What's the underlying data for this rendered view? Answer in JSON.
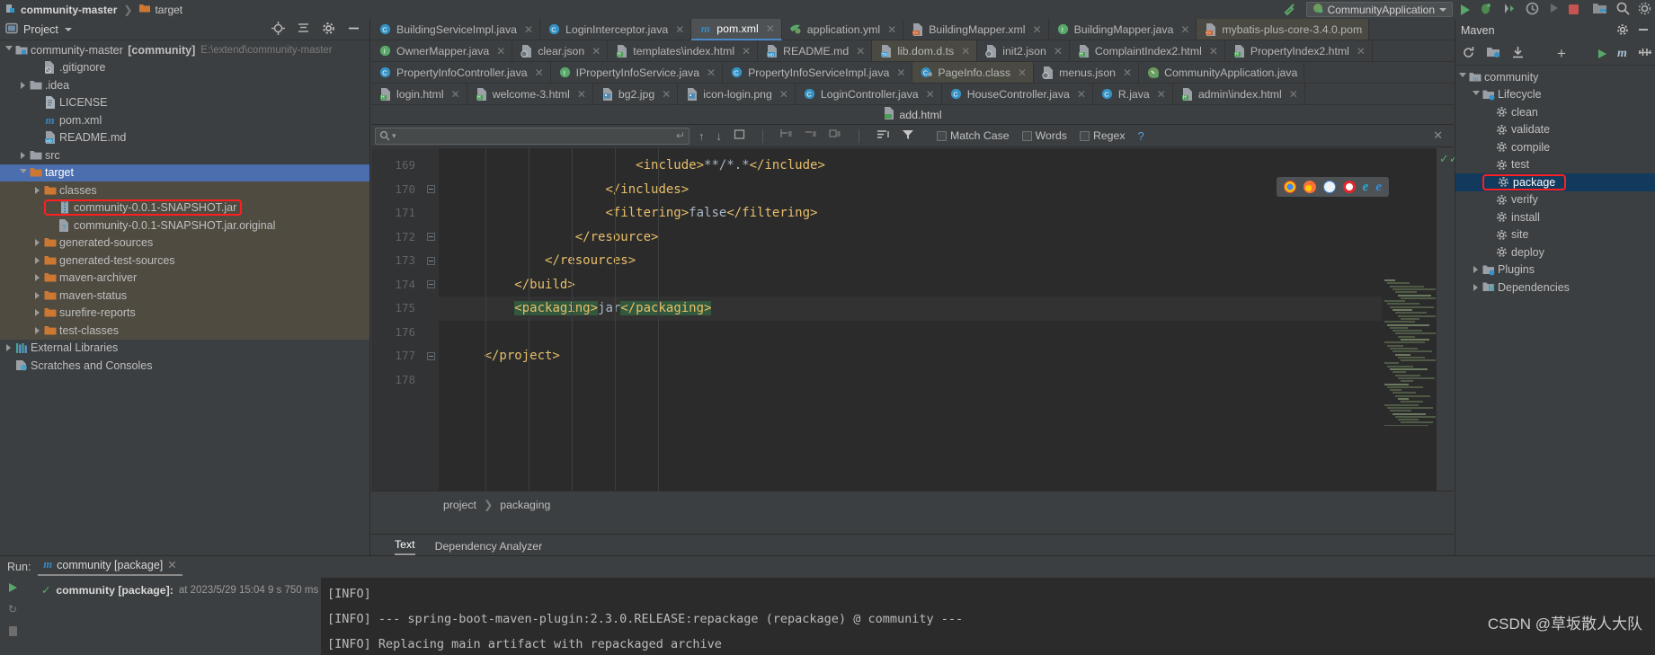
{
  "titlebar": {
    "breadcrumb": [
      "community-master",
      "target"
    ],
    "run_config": "CommunityApplication",
    "icons": [
      "hammer-icon",
      "play-icon",
      "debug-icon",
      "run-coverage-icon",
      "profiler-icon",
      "rerun-icon",
      "stop-icon",
      "open-folder-icon",
      "search-everywhere-icon"
    ]
  },
  "project_panel": {
    "title": "Project",
    "actions": [
      "locate-icon",
      "collapse-all-icon",
      "gear-icon",
      "minimize-icon"
    ],
    "tree": [
      {
        "label": "community-master",
        "bracket": "[community]",
        "path": "E:\\extend\\community-master",
        "indent": 0,
        "icon": "module-icon",
        "open": true,
        "arrow": "open"
      },
      {
        "label": ".gitignore",
        "indent": 2,
        "icon": "gitignore-icon",
        "arrow": "none"
      },
      {
        "label": ".idea",
        "indent": 1,
        "icon": "folder-gray-icon",
        "arrow": "closed"
      },
      {
        "label": "LICENSE",
        "indent": 2,
        "icon": "file-icon",
        "arrow": "none"
      },
      {
        "label": "pom.xml",
        "indent": 2,
        "icon": "maven-icon",
        "arrow": "none"
      },
      {
        "label": "README.md",
        "indent": 2,
        "icon": "markdown-icon",
        "arrow": "none"
      },
      {
        "label": "src",
        "indent": 1,
        "icon": "folder-gray-icon",
        "arrow": "closed"
      },
      {
        "label": "target",
        "indent": 1,
        "icon": "folder-orange-icon",
        "arrow": "open",
        "selected": true
      },
      {
        "label": "classes",
        "indent": 2,
        "icon": "folder-orange-icon",
        "arrow": "closed",
        "shaded": true
      },
      {
        "label": "community-0.0.1-SNAPSHOT.jar",
        "indent": 3,
        "icon": "jar-icon",
        "arrow": "none",
        "shaded": true,
        "highlight": true
      },
      {
        "label": "community-0.0.1-SNAPSHOT.jar.original",
        "indent": 3,
        "icon": "unknown-file-icon",
        "arrow": "none",
        "shaded": true
      },
      {
        "label": "generated-sources",
        "indent": 2,
        "icon": "folder-orange-icon",
        "arrow": "closed",
        "shaded": true
      },
      {
        "label": "generated-test-sources",
        "indent": 2,
        "icon": "folder-orange-icon",
        "arrow": "closed",
        "shaded": true
      },
      {
        "label": "maven-archiver",
        "indent": 2,
        "icon": "folder-orange-icon",
        "arrow": "closed",
        "shaded": true
      },
      {
        "label": "maven-status",
        "indent": 2,
        "icon": "folder-orange-icon",
        "arrow": "closed",
        "shaded": true
      },
      {
        "label": "surefire-reports",
        "indent": 2,
        "icon": "folder-orange-icon",
        "arrow": "closed",
        "shaded": true
      },
      {
        "label": "test-classes",
        "indent": 2,
        "icon": "folder-orange-icon",
        "arrow": "closed",
        "shaded": true
      },
      {
        "label": "External Libraries",
        "indent": 0,
        "icon": "libraries-icon",
        "arrow": "closed"
      },
      {
        "label": "Scratches and Consoles",
        "indent": 0,
        "icon": "scratches-icon",
        "arrow": "none"
      }
    ]
  },
  "editor": {
    "tab_rows": [
      [
        {
          "label": "BuildingServiceImpl.java",
          "icon": "class-icon",
          "close": true
        },
        {
          "label": "LoginInterceptor.java",
          "icon": "class-icon",
          "close": true
        },
        {
          "label": "pom.xml",
          "icon": "maven-icon",
          "close": true,
          "active": true
        },
        {
          "label": "application.yml",
          "icon": "yaml-icon",
          "close": true
        },
        {
          "label": "BuildingMapper.xml",
          "icon": "xml-icon",
          "close": true
        },
        {
          "label": "BuildingMapper.java",
          "icon": "interface-icon",
          "close": true
        },
        {
          "label": "mybatis-plus-core-3.4.0.pom",
          "icon": "xml-icon",
          "close": false,
          "shaded": true
        }
      ],
      [
        {
          "label": "OwnerMapper.java",
          "icon": "interface-icon",
          "close": true
        },
        {
          "label": "clear.json",
          "icon": "json-icon",
          "close": true
        },
        {
          "label": "templates\\index.html",
          "icon": "html-icon",
          "close": true
        },
        {
          "label": "README.md",
          "icon": "markdown-icon",
          "close": true
        },
        {
          "label": "lib.dom.d.ts",
          "icon": "typescript-icon",
          "close": true,
          "shaded": true
        },
        {
          "label": "init2.json",
          "icon": "json-icon",
          "close": true
        },
        {
          "label": "ComplaintIndex2.html",
          "icon": "html-icon",
          "close": true
        },
        {
          "label": "PropertyIndex2.html",
          "icon": "html-icon",
          "close": true
        }
      ],
      [
        {
          "label": "PropertyInfoController.java",
          "icon": "class-icon",
          "close": true
        },
        {
          "label": "IPropertyInfoService.java",
          "icon": "interface-icon",
          "close": true
        },
        {
          "label": "PropertyInfoServiceImpl.java",
          "icon": "class-icon",
          "close": true
        },
        {
          "label": "PageInfo.class",
          "icon": "class-file-icon",
          "close": true,
          "shaded": true
        },
        {
          "label": "menus.json",
          "icon": "json-icon",
          "close": true
        },
        {
          "label": "CommunityApplication.java",
          "icon": "spring-boot-icon",
          "close": false
        }
      ],
      [
        {
          "label": "login.html",
          "icon": "html-icon",
          "close": true
        },
        {
          "label": "welcome-3.html",
          "icon": "html-icon",
          "close": true
        },
        {
          "label": "bg2.jpg",
          "icon": "image-icon",
          "close": true
        },
        {
          "label": "icon-login.png",
          "icon": "image-icon",
          "close": true
        },
        {
          "label": "LoginController.java",
          "icon": "class-icon",
          "close": true
        },
        {
          "label": "HouseController.java",
          "icon": "class-icon",
          "close": true
        },
        {
          "label": "R.java",
          "icon": "class-icon",
          "close": true
        },
        {
          "label": "admin\\index.html",
          "icon": "html-icon",
          "close": true
        }
      ]
    ],
    "overflow_tab": {
      "label": "add.html",
      "icon": "html-icon",
      "close": true
    },
    "find_bar": {
      "placeholder": "",
      "value": "",
      "buttons": [
        "prev-match-icon",
        "next-match-icon",
        "select-all-icon",
        "add-line-icon",
        "remove-line-icon",
        "select-occurrence-icon",
        "filter-lines-icon",
        "filter-icon"
      ],
      "options": [
        {
          "label": "Match Case",
          "checked": false
        },
        {
          "label": "Words",
          "checked": false
        },
        {
          "label": "Regex",
          "checked": false
        }
      ],
      "help": "?"
    },
    "code": {
      "first_line": 169,
      "lines": [
        {
          "n": 169,
          "indent": 26,
          "fold": false,
          "segments": [
            {
              "t": "<include>",
              "c": "tag"
            },
            {
              "t": "**/*.*",
              "c": "text"
            },
            {
              "t": "</include>",
              "c": "tag"
            }
          ]
        },
        {
          "n": 170,
          "indent": 22,
          "fold": true,
          "segments": [
            {
              "t": "</includes>",
              "c": "tag"
            }
          ]
        },
        {
          "n": 171,
          "indent": 22,
          "fold": false,
          "segments": [
            {
              "t": "<filtering>",
              "c": "tag"
            },
            {
              "t": "false",
              "c": "text"
            },
            {
              "t": "</filtering>",
              "c": "tag"
            }
          ]
        },
        {
          "n": 172,
          "indent": 18,
          "fold": true,
          "segments": [
            {
              "t": "</resource>",
              "c": "tag"
            }
          ]
        },
        {
          "n": 173,
          "indent": 14,
          "fold": true,
          "segments": [
            {
              "t": "</resources>",
              "c": "tag"
            }
          ]
        },
        {
          "n": 174,
          "indent": 10,
          "fold": true,
          "segments": [
            {
              "t": "</build>",
              "c": "tag"
            }
          ]
        },
        {
          "n": 175,
          "indent": 10,
          "fold": false,
          "current": true,
          "segments": [
            {
              "t": "<packaging>",
              "c": "tag-hl"
            },
            {
              "t": "jar",
              "c": "text"
            },
            {
              "t": "</packaging>",
              "c": "tag-hl"
            }
          ]
        },
        {
          "n": 176,
          "indent": 0,
          "fold": false,
          "segments": []
        },
        {
          "n": 177,
          "indent": 6,
          "fold": true,
          "segments": [
            {
              "t": "</project>",
              "c": "tag"
            }
          ]
        },
        {
          "n": 178,
          "indent": 0,
          "fold": false,
          "segments": []
        }
      ]
    },
    "browser_popup": [
      "chrome-icon",
      "firefox-icon",
      "safari-icon",
      "opera-icon",
      "ie-icon",
      "edge-icon"
    ],
    "breadcrumb": [
      "project",
      "packaging"
    ],
    "bottom_tabs": [
      {
        "label": "Text",
        "active": true
      },
      {
        "label": "Dependency Analyzer",
        "active": false
      }
    ]
  },
  "maven_panel": {
    "title": "Maven",
    "toolbar": [
      "reload-icon",
      "generate-sources-icon",
      "download-sources-icon",
      "add-icon",
      "run-icon",
      "execute-goal-icon",
      "toggle-skip-tests-icon",
      "show-diagram-icon"
    ],
    "tree": [
      {
        "label": "community",
        "indent": 0,
        "icon": "maven-project-icon",
        "arrow": "open"
      },
      {
        "label": "Lifecycle",
        "indent": 1,
        "icon": "lifecycle-folder-icon",
        "arrow": "open"
      },
      {
        "label": "clean",
        "indent": 2,
        "icon": "goal-icon",
        "arrow": "none"
      },
      {
        "label": "validate",
        "indent": 2,
        "icon": "goal-icon",
        "arrow": "none"
      },
      {
        "label": "compile",
        "indent": 2,
        "icon": "goal-icon",
        "arrow": "none"
      },
      {
        "label": "test",
        "indent": 2,
        "icon": "goal-icon",
        "arrow": "none"
      },
      {
        "label": "package",
        "indent": 2,
        "icon": "goal-icon",
        "arrow": "none",
        "selected": true,
        "highlight": true
      },
      {
        "label": "verify",
        "indent": 2,
        "icon": "goal-icon",
        "arrow": "none"
      },
      {
        "label": "install",
        "indent": 2,
        "icon": "goal-icon",
        "arrow": "none"
      },
      {
        "label": "site",
        "indent": 2,
        "icon": "goal-icon",
        "arrow": "none"
      },
      {
        "label": "deploy",
        "indent": 2,
        "icon": "goal-icon",
        "arrow": "none"
      },
      {
        "label": "Plugins",
        "indent": 1,
        "icon": "plugins-folder-icon",
        "arrow": "closed"
      },
      {
        "label": "Dependencies",
        "indent": 1,
        "icon": "dependencies-icon",
        "arrow": "closed"
      }
    ]
  },
  "run_panel": {
    "label": "Run:",
    "tab": {
      "label": "community [package]",
      "icon": "maven-icon",
      "close": true
    },
    "gutter_icons": [
      "rerun-icon",
      "toggle-tasks-icon",
      "stop-icon"
    ],
    "tree_node": {
      "status": "success-check-icon",
      "title": "community [package]:",
      "meta": "at 2023/5/29 15:04 9 s 750 ms"
    },
    "output": [
      "[INFO]",
      "[INFO] --- spring-boot-maven-plugin:2.3.0.RELEASE:repackage (repackage) @ community ---",
      "[INFO] Replacing main artifact with repackaged archive"
    ]
  },
  "watermark": "CSDN @草坂散人大队",
  "colors": {
    "bg": "#3c3f41",
    "editor_bg": "#2b2b2b",
    "selection": "#4b6eaf",
    "highlight_red": "#ff1f1f",
    "tag": "#e8bf6a",
    "bracket": "#a9b7c6",
    "accent_green": "#59a869",
    "folder_orange": "#cc7832",
    "shade": "#4f4b41"
  }
}
